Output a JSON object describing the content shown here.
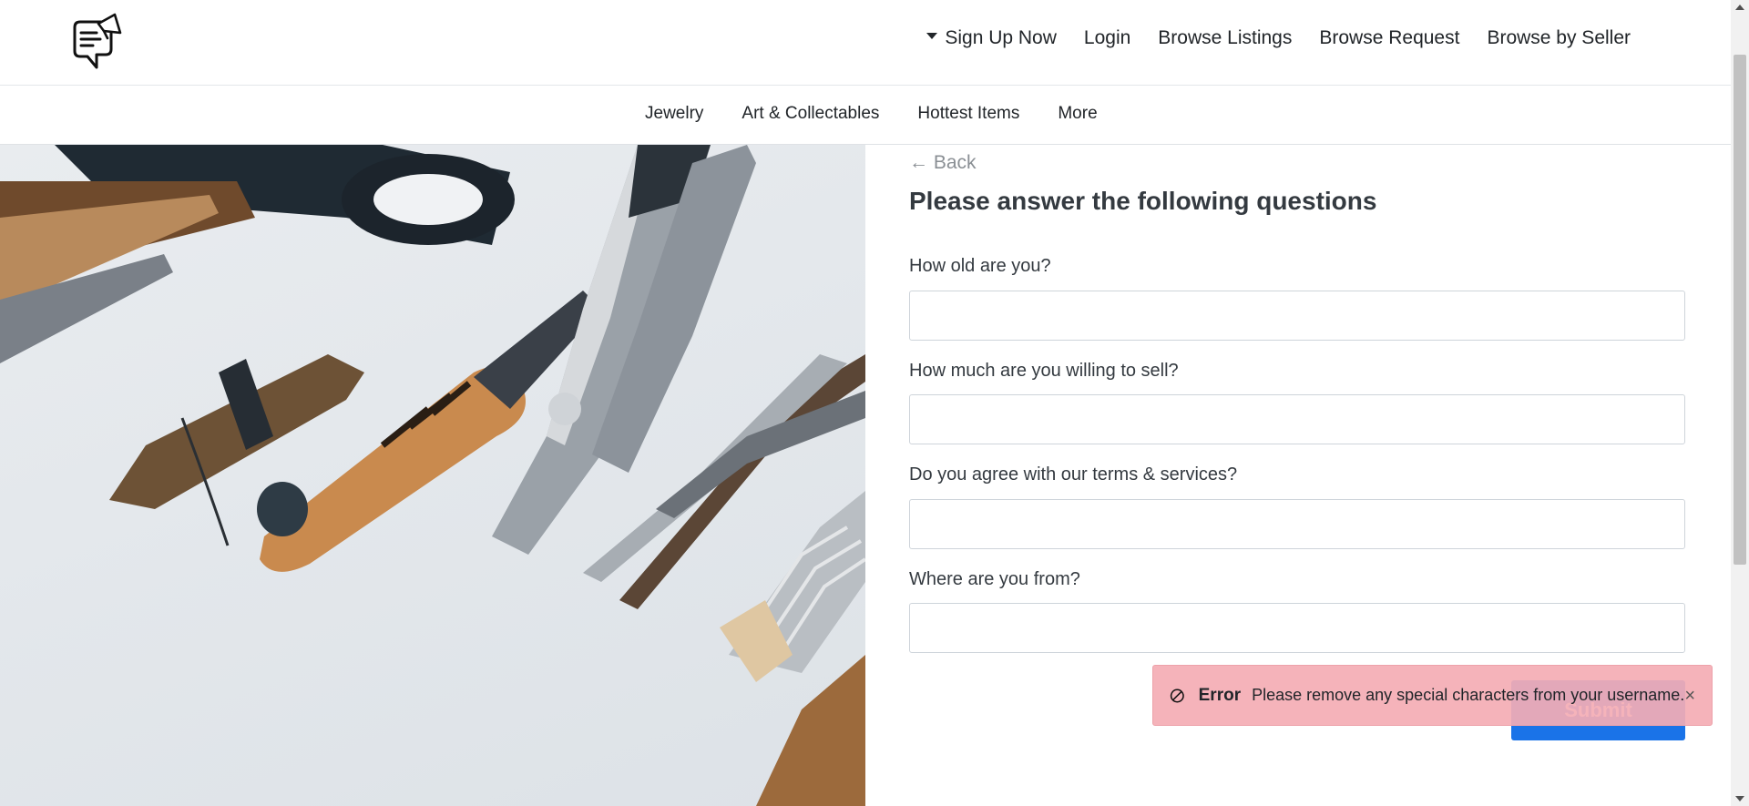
{
  "header": {
    "logo_icon": "megaphone-chat-icon",
    "nav": [
      {
        "label": "Sign Up Now",
        "has_caret": true
      },
      {
        "label": "Login"
      },
      {
        "label": "Browse Listings"
      },
      {
        "label": "Browse Request"
      },
      {
        "label": "Browse by Seller"
      }
    ]
  },
  "categories": [
    "Jewelry",
    "Art & Collectables",
    "Hottest Items",
    "More"
  ],
  "hero": {
    "icon": "craft-tools-photo"
  },
  "form": {
    "back_label": "← Back",
    "title": "Please answer the following questions",
    "questions": [
      {
        "label": "How old are you?",
        "value": ""
      },
      {
        "label": "How much are you willing to sell?",
        "value": ""
      },
      {
        "label": "Do you agree with our terms & services?",
        "value": ""
      },
      {
        "label": "Where are you from?",
        "value": ""
      }
    ],
    "submit_label": "Submit",
    "submit_color": "#1a73e8"
  },
  "toast": {
    "title": "Error",
    "message": "Please remove any special characters from your username.",
    "close": "×",
    "icon": "ban-icon",
    "background": "#f4adb4"
  }
}
